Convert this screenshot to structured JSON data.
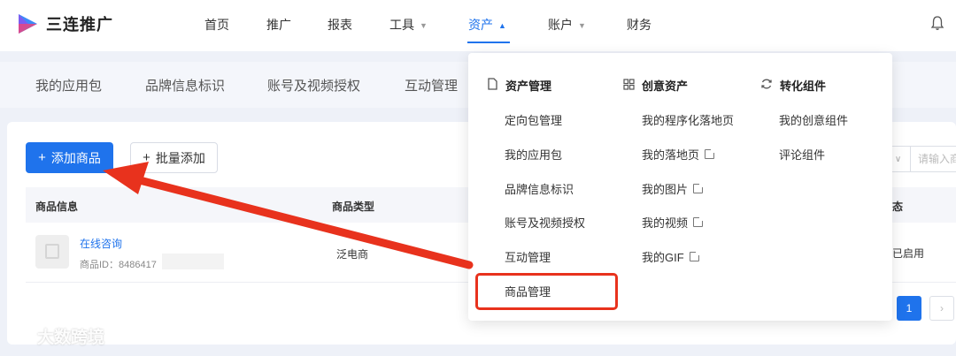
{
  "app": {
    "name": "三连推广"
  },
  "nav": {
    "items": [
      {
        "label": "首页"
      },
      {
        "label": "推广"
      },
      {
        "label": "报表"
      },
      {
        "label": "工具",
        "caret": "▼"
      },
      {
        "label": "资产",
        "caret": "▲"
      },
      {
        "label": "账户",
        "caret": "▼"
      },
      {
        "label": "财务"
      }
    ],
    "active": "资产"
  },
  "subnav": {
    "tabs": [
      {
        "label": "我的应用包"
      },
      {
        "label": "品牌信息标识"
      },
      {
        "label": "账号及视频授权"
      },
      {
        "label": "互动管理"
      }
    ]
  },
  "toolbar": {
    "add_label": "添加商品",
    "batch_label": "批量添加",
    "search_placeholder": "请输入商"
  },
  "table": {
    "columns": [
      {
        "label": "商品信息"
      },
      {
        "label": "商品类型"
      },
      {
        "label": "态"
      }
    ],
    "rows": [
      {
        "name": "在线咨询",
        "id_text": "商品ID：8486417",
        "type": "泛电商",
        "status": "已启用"
      }
    ]
  },
  "pagination": {
    "current": "1",
    "next": "›"
  },
  "dropdown": {
    "columns": [
      {
        "title": "资产管理",
        "icon": "file-icon",
        "items": [
          "定向包管理",
          "我的应用包",
          "品牌信息标识",
          "账号及视频授权",
          "互动管理",
          "商品管理"
        ]
      },
      {
        "title": "创意资产",
        "icon": "grid-icon",
        "items": [
          "我的程序化落地页",
          "我的落地页",
          "我的图片",
          "我的视频",
          "我的GIF"
        ]
      },
      {
        "title": "转化组件",
        "icon": "refresh-icon",
        "items": [
          "我的创意组件",
          "评论组件"
        ]
      }
    ],
    "highlighted": "商品管理"
  },
  "watermark": {
    "text": "大数跨境"
  },
  "colors": {
    "brand_blue": "#1f73ec",
    "annotation_red": "#e8321d"
  }
}
